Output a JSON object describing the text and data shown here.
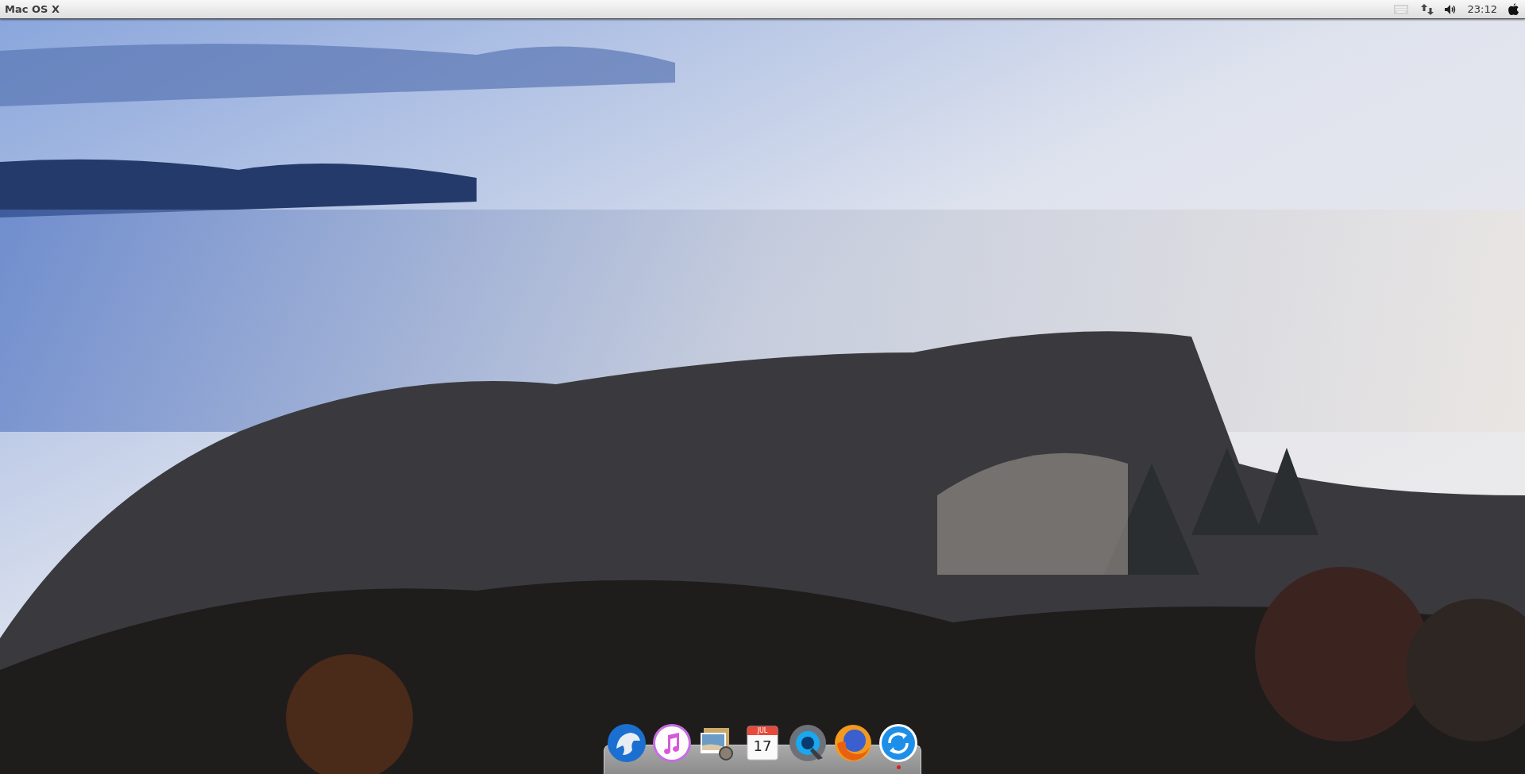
{
  "menubar": {
    "title": "Mac OS X",
    "clock": "23:12"
  },
  "dock": {
    "items": [
      {
        "kind": "eagle",
        "running": false
      },
      {
        "kind": "music",
        "running": false
      },
      {
        "kind": "preview",
        "running": false
      },
      {
        "kind": "calendar",
        "month": "JUL",
        "day": "17",
        "running": false
      },
      {
        "kind": "quicktime",
        "running": false
      },
      {
        "kind": "firefox",
        "running": false
      },
      {
        "kind": "sync",
        "running": true
      }
    ]
  }
}
